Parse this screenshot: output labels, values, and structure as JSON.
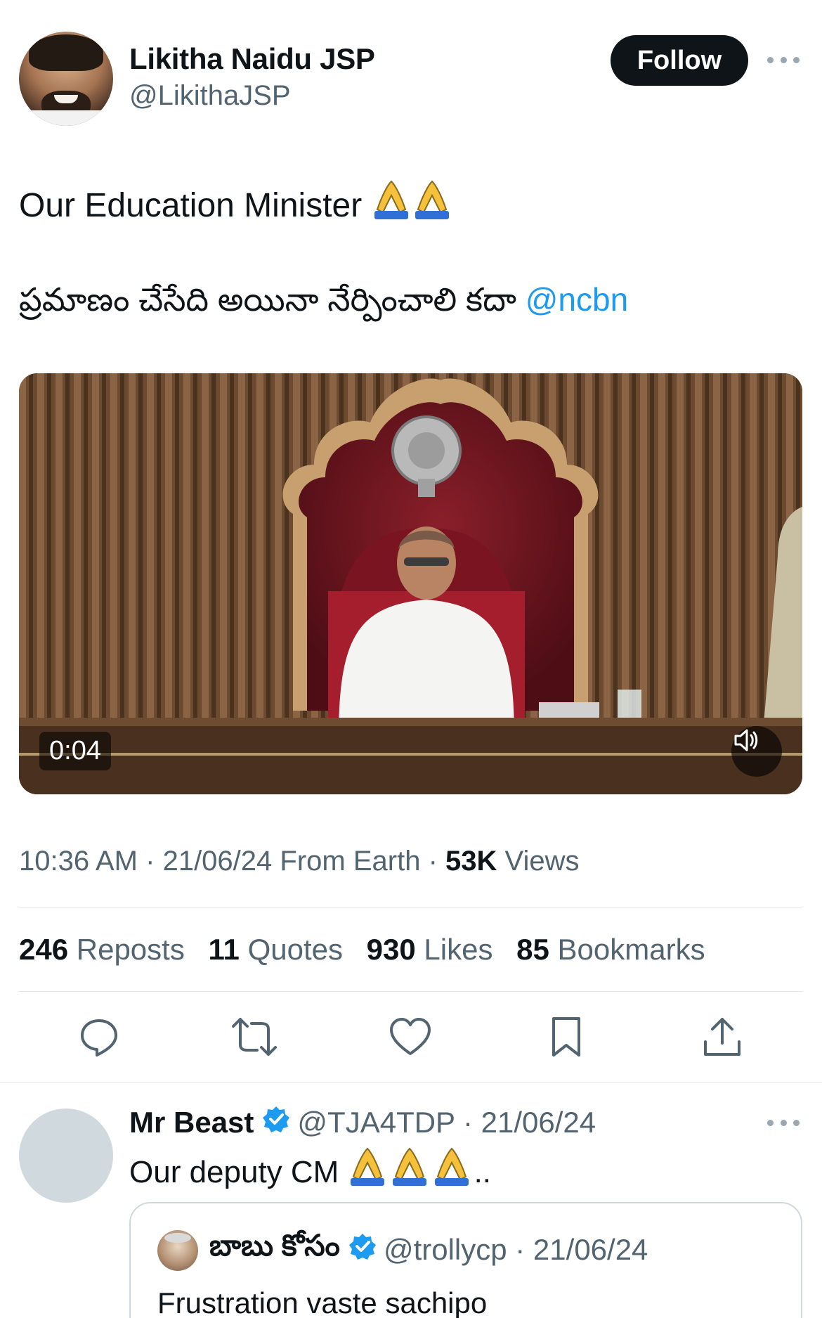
{
  "author": {
    "display_name": "Likitha Naidu JSP",
    "handle": "@LikithaJSP",
    "follow_label": "Follow"
  },
  "tweet": {
    "line1": "Our Education Minister",
    "line2_telugu": "ప్రమాణం చేసేది అయినా నేర్పించాలి కదా",
    "mention": "@ncbn",
    "emoji": "🙏🙏"
  },
  "video": {
    "duration": "0:04",
    "mute_icon": "speaker-icon"
  },
  "meta": {
    "time": "10:36 AM",
    "date": "21/06/24",
    "source": "From Earth",
    "views_count": "53K",
    "views_label": "Views"
  },
  "stats": {
    "reposts_count": "246",
    "reposts_label": "Reposts",
    "quotes_count": "11",
    "quotes_label": "Quotes",
    "likes_count": "930",
    "likes_label": "Likes",
    "bookmarks_count": "85",
    "bookmarks_label": "Bookmarks"
  },
  "actions": [
    "reply-icon",
    "repost-icon",
    "like-icon",
    "bookmark-icon",
    "share-icon"
  ],
  "reply": {
    "name": "Mr Beast",
    "handle_date": "@TJA4TDP · 21/06/24",
    "text": "Our deputy CM",
    "trailing": ".."
  },
  "quote": {
    "name": "బాబు కోసం",
    "handle_date": "@trollycp · 21/06/24",
    "text": "Frustration vaste sachipo"
  },
  "colors": {
    "link": "#1d9bf0",
    "secondary": "#536471",
    "verified": "#1d9bf0"
  }
}
